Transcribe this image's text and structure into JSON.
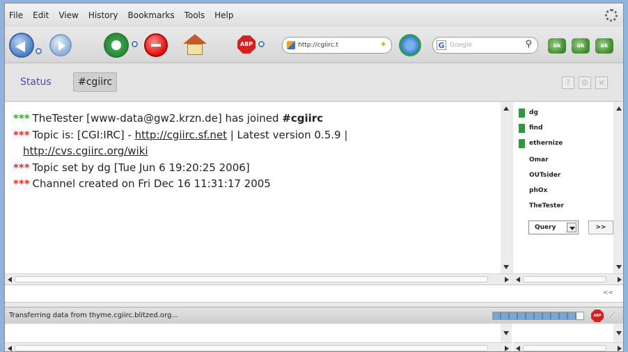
{
  "menu": {
    "items": [
      {
        "label": "File"
      },
      {
        "label": "Edit"
      },
      {
        "label": "View"
      },
      {
        "label": "History"
      },
      {
        "label": "Bookmarks"
      },
      {
        "label": "Tools"
      },
      {
        "label": "Help"
      }
    ]
  },
  "toolbar": {
    "url": "http://cgiirc.t",
    "search_placeholder": "Google",
    "abp_label": "ABP",
    "ext_label": "ok"
  },
  "tabs": {
    "status_label": "Status",
    "channel_label": "#cgiirc"
  },
  "messages": {
    "line1_star": "***",
    "line1_text": "TheTester [www-data@gw2.krzn.de] has joined ",
    "line1_channel": "#cgiirc",
    "line2_star": "***",
    "line2_prefix": "Topic is: [CGI:IRC] - ",
    "line2_link": "http://cgiirc.sf.net",
    "line2_suffix": " | Latest version 0.5.9 |",
    "line2_link2": "http://cvs.cgiirc.org/wiki",
    "line3_star": "***",
    "line3_text": "Topic set by dg [Tue Jun  6 19:20:25 2006]",
    "line4_star": "***",
    "line4_text": "Channel created on Fri Dec 16 11:31:17 2005"
  },
  "nicklist": {
    "nicks": [
      {
        "name": "dg",
        "op": true
      },
      {
        "name": "find",
        "op": true
      },
      {
        "name": "ethernize",
        "op": true
      },
      {
        "name": "Omar",
        "op": false
      },
      {
        "name": "OUTsider",
        "op": false
      },
      {
        "name": "phOx",
        "op": false
      },
      {
        "name": "TheTester",
        "op": false
      }
    ],
    "query_label": "Query",
    "go_label": ">>"
  },
  "input": {
    "collapse_label": "<<"
  },
  "statusbar": {
    "text": "Transferring data from thyme.cgiirc.blitzed.org...",
    "progress": 0.92,
    "abp_label": "ABP"
  },
  "colors": {
    "accent": "#4a4ab0",
    "join_star": "#33aa33",
    "info_star": "#dd3333",
    "op_badge": "#2a9a3a"
  }
}
